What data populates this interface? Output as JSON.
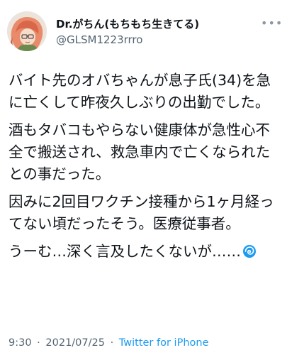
{
  "user": {
    "display_name": "Dr.がちん(もちもち生きてる)",
    "handle": "@GLSM1223rrro"
  },
  "more_icon": "more-horizontal-icon",
  "tweet": {
    "paragraphs": [
      "バイト先のオバちゃんが息子氏(34)を急に亡くして昨夜久しぶりの出勤でした。",
      "酒もタバコもやらない健康体が急性心不全で搬送され、救急車内で亡くなられたとの事だった。",
      "因みに2回目ワクチン接種から1ヶ月経ってない頃だったそう。医療従事者。",
      "うーむ…深く言及したくないが……"
    ],
    "trailing_emoji": "cyclone-icon"
  },
  "meta": {
    "time": "9:30",
    "separator": "·",
    "date": "2021/07/25",
    "source": "Twitter for iPhone"
  },
  "colors": {
    "text": "#0f1419",
    "secondary": "#536471",
    "link": "#1d9bf0"
  }
}
